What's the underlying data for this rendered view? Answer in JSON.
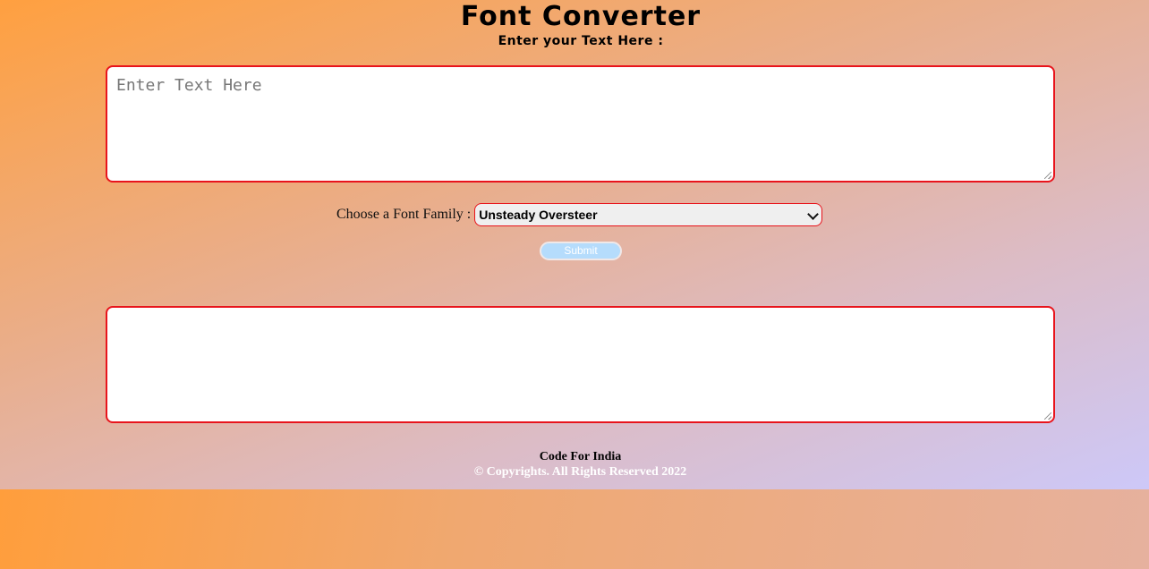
{
  "header": {
    "title": "Font Converter",
    "subtitle": "Enter your Text Here :"
  },
  "input": {
    "placeholder": "Enter Text Here",
    "value": ""
  },
  "font_select": {
    "label": "Choose a Font Family :",
    "selected": "Unsteady Oversteer"
  },
  "submit": {
    "label": "Submit"
  },
  "output": {
    "value": ""
  },
  "footer": {
    "title": "Code For India",
    "copyright": "© Copyrights. All Rights Reserved 2022"
  },
  "colors": {
    "border_accent": "#e8141c",
    "submit_bg": "#b5dcfc",
    "gradient_start": "#ff9a3c",
    "gradient_end": "#ccc8f8"
  }
}
